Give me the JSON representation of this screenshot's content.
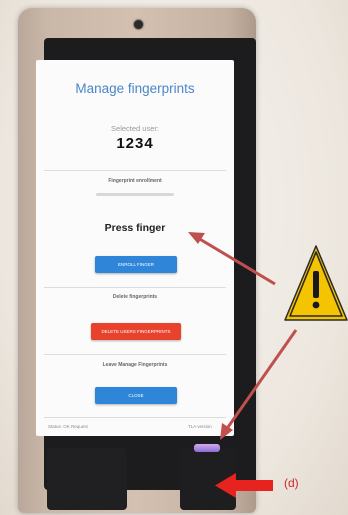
{
  "screen": {
    "title": "Manage fingerprints",
    "selected_user_label": "Selected user:",
    "selected_user_value": "1234",
    "enrollment_label": "Fingerprint enrollment",
    "enrollment_progress": 0.0,
    "prompt": "Press finger",
    "enroll_button": "ENROLL FINGER",
    "delete_label": "Delete fingerprints",
    "delete_button": "DELETE USERS FINGERPRINTS",
    "leave_label": "Leave Manage Fingerprints",
    "close_button": "CLOSE",
    "status_left": "Status: OK Request",
    "status_right": "TLA version"
  },
  "annotations": {
    "marker_label": "(d)",
    "warning_icon": "warning-triangle-icon",
    "colors": {
      "arrow": "#c0504d",
      "callout_arrow": "#e6231e",
      "warning_fill": "#f5c400"
    }
  },
  "colors": {
    "title": "#4a86c8",
    "primary_button": "#2f86d8",
    "danger_button": "#e8412c"
  }
}
